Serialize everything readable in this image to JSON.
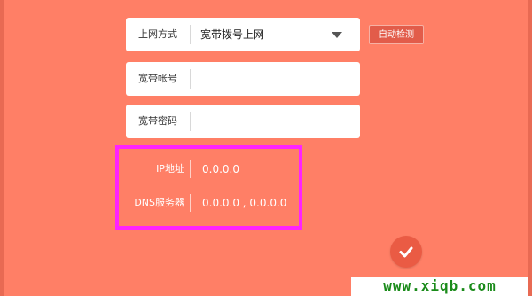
{
  "form": {
    "connection_type": {
      "label": "上网方式",
      "value": "宽带拨号上网"
    },
    "detect_button": "自动检测",
    "account": {
      "label": "宽带帐号",
      "value": ""
    },
    "password": {
      "label": "宽带密码",
      "value": ""
    }
  },
  "status": {
    "ip": {
      "label": "IP地址",
      "value": "0.0.0.0"
    },
    "dns": {
      "label": "DNS服务器",
      "value": "0.0.0.0 , 0.0.0.0"
    }
  },
  "icons": {
    "dropdown": "chevron-down-icon",
    "confirm": "checkmark-icon"
  },
  "colors": {
    "background": "#ff7f66",
    "highlight": "#ff22ff",
    "button": "#e25c4a"
  },
  "watermark": "www.xiqb.com"
}
